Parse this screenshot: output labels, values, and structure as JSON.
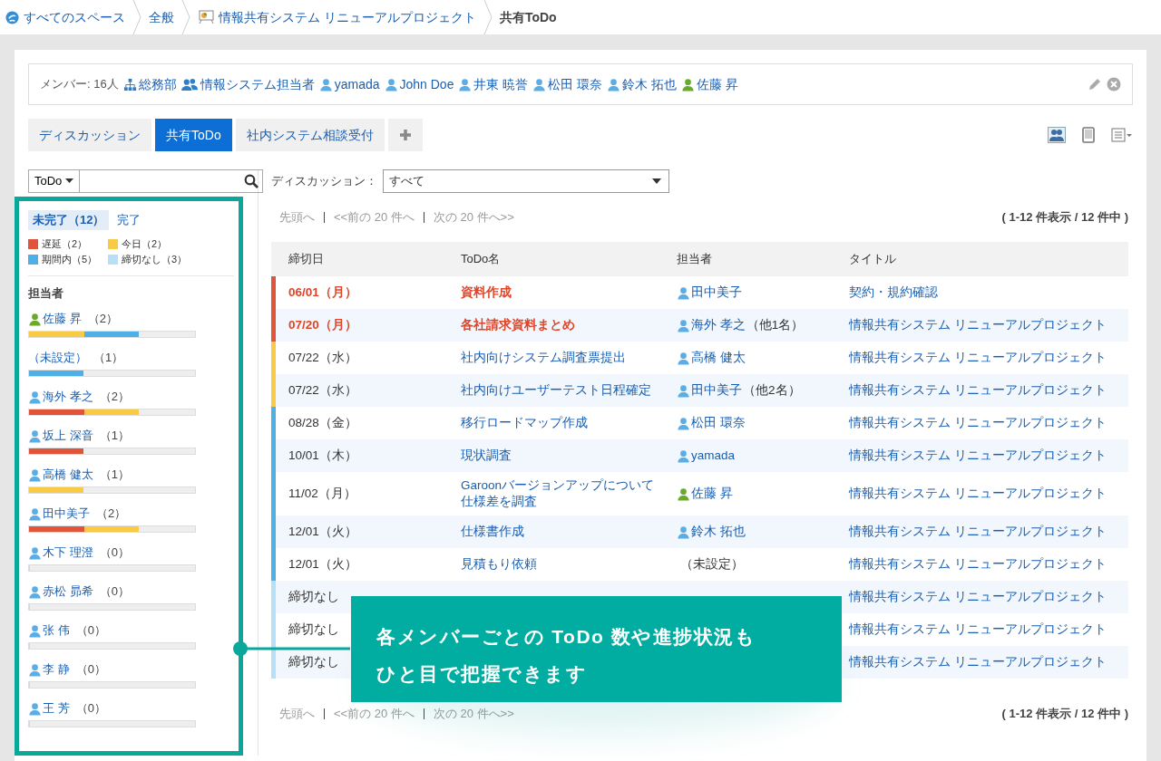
{
  "breadcrumb": [
    {
      "label": "すべてのスペース",
      "kind": "home"
    },
    {
      "label": "全般",
      "kind": "link"
    },
    {
      "label": "情報共有システム リニューアルプロジェクト",
      "kind": "space"
    },
    {
      "label": "共有ToDo",
      "kind": "current"
    }
  ],
  "members": {
    "label": "メンバー: 16人",
    "items": [
      {
        "name": "総務部",
        "kind": "org"
      },
      {
        "name": "情報システム担当者",
        "kind": "group"
      },
      {
        "name": "yamada",
        "kind": "user",
        "color": "#5aaee8"
      },
      {
        "name": "John Doe",
        "kind": "user",
        "color": "#5aaee8"
      },
      {
        "name": "井東 暁誉",
        "kind": "user",
        "color": "#5aaee8"
      },
      {
        "name": "松田 環奈",
        "kind": "user",
        "color": "#5aaee8"
      },
      {
        "name": "鈴木 拓也",
        "kind": "user",
        "color": "#5aaee8"
      },
      {
        "name": "佐藤 昇",
        "kind": "user",
        "color": "#6aaa2a"
      }
    ]
  },
  "tabs": [
    {
      "label": "ディスカッション",
      "selected": false
    },
    {
      "label": "共有ToDo",
      "selected": true
    },
    {
      "label": "社内システム相談受付",
      "selected": false
    }
  ],
  "search": {
    "category": "ToDo"
  },
  "filter_tabs": [
    {
      "label": "未完了（12）",
      "selected": true
    },
    {
      "label": "完了",
      "selected": false
    }
  ],
  "legend": [
    {
      "label": "遅延（2）",
      "color": "#e0553a"
    },
    {
      "label": "今日（2）",
      "color": "#f9cb45"
    },
    {
      "label": "期間内（5）",
      "color": "#4fb0e6"
    },
    {
      "label": "締切なし（3）",
      "color": "#b5e0f8"
    }
  ],
  "assignee_heading": "担当者",
  "assignees": [
    {
      "name": "佐藤 昇",
      "count": "（2）",
      "kind": "user",
      "color": "#6aaa2a",
      "level": 0.66,
      "bar": [
        {
          "color": "#f9cb45"
        },
        {
          "color": "#4fb0e6"
        }
      ]
    },
    {
      "name": "（未設定）",
      "count": "（1）",
      "kind": "unset",
      "level": 0.33,
      "bar": [
        {
          "color": "#4fb0e6"
        }
      ]
    },
    {
      "name": "海外 孝之",
      "count": "（2）",
      "kind": "user",
      "color": "#5aaee8",
      "level": 0.66,
      "bar": [
        {
          "color": "#e0553a"
        },
        {
          "color": "#f9cb45"
        }
      ]
    },
    {
      "name": "坂上 深音",
      "count": "（1）",
      "kind": "user",
      "color": "#5aaee8",
      "level": 0.33,
      "bar": [
        {
          "color": "#e0553a"
        }
      ]
    },
    {
      "name": "高橋 健太",
      "count": "（1）",
      "kind": "user",
      "color": "#5aaee8",
      "level": 0.33,
      "bar": [
        {
          "color": "#f9cb45"
        }
      ]
    },
    {
      "name": "田中美子",
      "count": "（2）",
      "kind": "user",
      "color": "#5aaee8",
      "level": 0.66,
      "bar": [
        {
          "color": "#e0553a"
        },
        {
          "color": "#f9cb45"
        }
      ]
    },
    {
      "name": "木下 理澄",
      "count": "（0）",
      "kind": "user",
      "color": "#5aaee8",
      "level": 0
    },
    {
      "name": "赤松 昴希",
      "count": "（0）",
      "kind": "user",
      "color": "#5aaee8",
      "level": 0
    },
    {
      "name": "张 伟",
      "count": "（0）",
      "kind": "user",
      "color": "#5aaee8",
      "level": 0
    },
    {
      "name": "李 静",
      "count": "（0）",
      "kind": "user",
      "color": "#5aaee8",
      "level": 0
    },
    {
      "name": "王 芳",
      "count": "（0）",
      "kind": "user",
      "color": "#5aaee8",
      "level": 0
    }
  ],
  "discussion_filter": {
    "label": "ディスカッション：",
    "value": "すべて"
  },
  "pager_top": {
    "first": "先頭へ",
    "prev": "<<前の 20 件へ",
    "next": "次の 20 件へ>>",
    "summary": "( 1-12 件表示 / 12 件中 )"
  },
  "table": {
    "columns": [
      "締切日",
      "ToDo名",
      "担当者",
      "タイトル"
    ],
    "rows": [
      {
        "kind": "overdue",
        "due": "06/01（月）",
        "name": "資料作成",
        "assignee": {
          "name": "田中美子",
          "kind": "user",
          "color": "#5aaee8"
        },
        "title": "契約・規約確認"
      },
      {
        "kind": "overdue",
        "due": "07/20（月）",
        "name": "各社請求資料まとめ",
        "assignee": {
          "name": "海外 孝之",
          "others": "（他1名）",
          "kind": "user",
          "color": "#5aaee8"
        },
        "title": "情報共有システム リニューアルプロジェクト"
      },
      {
        "kind": "today",
        "due": "07/22（水）",
        "name": "社内向けシステム調査票提出",
        "assignee": {
          "name": "高橋 健太",
          "kind": "user",
          "color": "#5aaee8"
        },
        "title": "情報共有システム リニューアルプロジェクト"
      },
      {
        "kind": "today",
        "due": "07/22（水）",
        "name": "社内向けユーザーテスト日程確定",
        "assignee": {
          "name": "田中美子",
          "others": "（他2名）",
          "kind": "user",
          "color": "#5aaee8"
        },
        "title": "情報共有システム リニューアルプロジェクト"
      },
      {
        "kind": "period",
        "due": "08/28（金）",
        "name": "移行ロードマップ作成",
        "assignee": {
          "name": "松田 環奈",
          "kind": "user",
          "color": "#5aaee8"
        },
        "title": "情報共有システム リニューアルプロジェクト"
      },
      {
        "kind": "period",
        "due": "10/01（木）",
        "name": "現状調査",
        "assignee": {
          "name": "yamada",
          "kind": "user",
          "color": "#5aaee8"
        },
        "title": "情報共有システム リニューアルプロジェクト"
      },
      {
        "kind": "period",
        "due": "11/02（月）",
        "name": "Garoonバージョンアップについて仕様差を調査",
        "assignee": {
          "name": "佐藤 昇",
          "kind": "user",
          "color": "#6aaa2a"
        },
        "title": "情報共有システム リニューアルプロジェクト"
      },
      {
        "kind": "period",
        "due": "12/01（火）",
        "name": "仕様書作成",
        "assignee": {
          "name": "鈴木 拓也",
          "kind": "user",
          "color": "#5aaee8"
        },
        "title": "情報共有システム リニューアルプロジェクト"
      },
      {
        "kind": "period",
        "due": "12/01（火）",
        "name": "見積もり依頼",
        "assignee": {
          "name": "（未設定）",
          "kind": "unset"
        },
        "title": "情報共有システム リニューアルプロジェクト"
      },
      {
        "kind": "none",
        "due": "締切なし",
        "title": "情報共有システム リニューアルプロジェクト"
      },
      {
        "kind": "none",
        "due": "締切なし",
        "title": "情報共有システム リニューアルプロジェクト"
      },
      {
        "kind": "none",
        "due": "締切なし",
        "title": "情報共有システム リニューアルプロジェクト"
      }
    ]
  },
  "pager_bottom": {
    "first": "先頭へ",
    "prev": "<<前の 20 件へ",
    "next": "次の 20 件へ>>",
    "summary": "( 1-12 件表示 / 12 件中 )"
  },
  "callout": {
    "lines": [
      "各メンバーごとの ToDo 数や進捗状況も",
      "ひと目で把握できます"
    ]
  }
}
